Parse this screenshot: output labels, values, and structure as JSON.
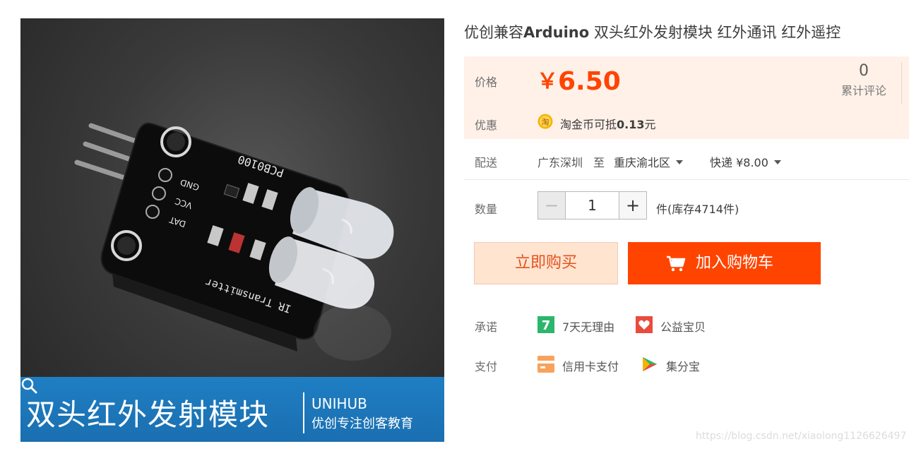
{
  "product": {
    "title_prefix": "优创兼容",
    "title_bold": "Arduino",
    "title_suffix": " 双头红外发射模块 红外通讯 红外遥控"
  },
  "gallery": {
    "banner_title": "双头红外发射模块",
    "brand": "UNIHUB",
    "slogan": "优创专注创客教育",
    "board_label_top": "PCB0100",
    "board_labels_pins": [
      "GND",
      "VCC",
      "DAT"
    ],
    "board_label_bottom": "IR Transmitter"
  },
  "price": {
    "label": "价格",
    "currency": "￥",
    "amount": "6.50",
    "review_count": "0",
    "review_label": "累计评论"
  },
  "promo": {
    "label": "优惠",
    "text_prefix": "淘金币可抵",
    "amount": "0.13",
    "text_suffix": "元"
  },
  "shipping": {
    "label": "配送",
    "from": "广东深圳",
    "to_word": "至",
    "destination": "重庆渝北区",
    "method": "快递 ¥8.00"
  },
  "quantity": {
    "label": "数量",
    "minus": "−",
    "value": "1",
    "plus": "+",
    "stock": "件(库存4714件)"
  },
  "buttons": {
    "buy_now": "立即购买",
    "add_to_cart": "加入购物车"
  },
  "promise": {
    "label": "承诺",
    "items": [
      "7天无理由",
      "公益宝贝"
    ]
  },
  "payment": {
    "label": "支付",
    "items": [
      "信用卡支付",
      "集分宝"
    ]
  },
  "watermark": "https://blog.csdn.net/xiaolong1126626497",
  "colors": {
    "accent": "#ff4400",
    "price_bg": "#fff1e8",
    "buy_now_bg": "#ffe4d0",
    "banner": "#1f7ec3"
  }
}
